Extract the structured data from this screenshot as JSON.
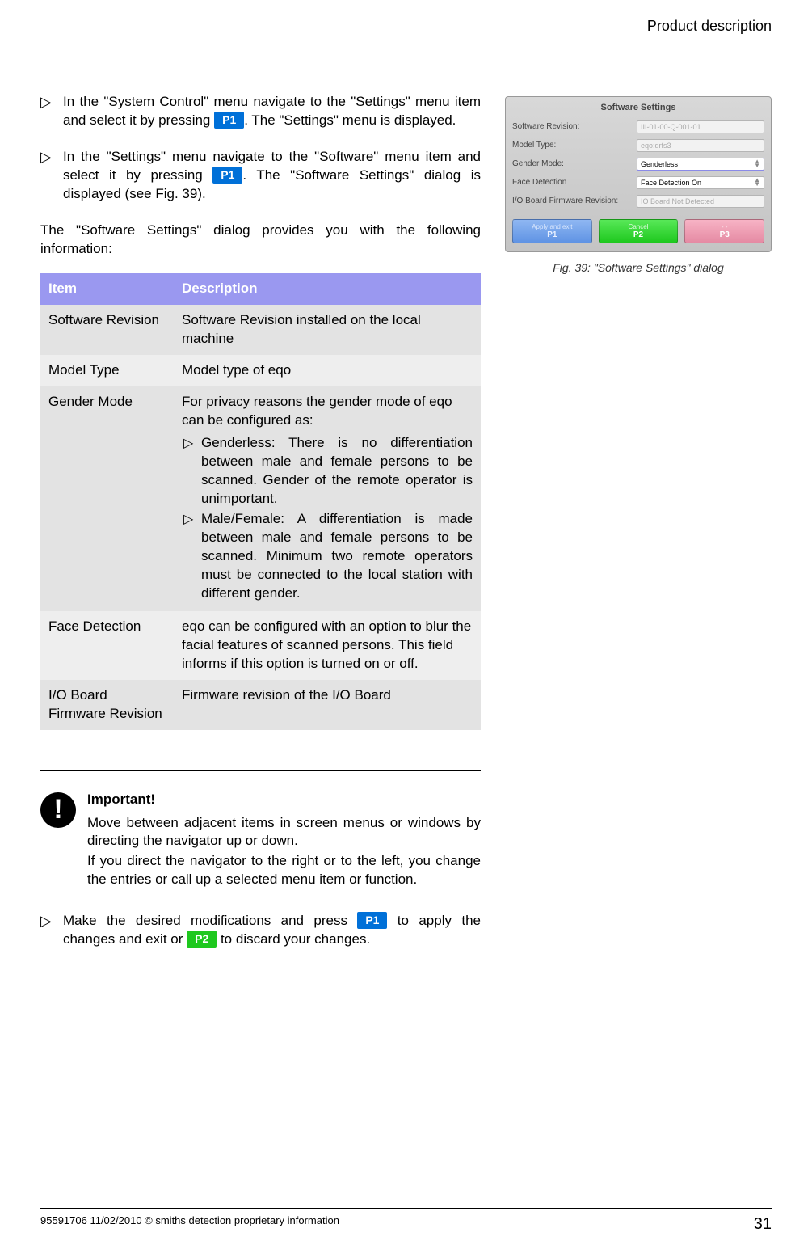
{
  "header": {
    "title": "Product description"
  },
  "steps": {
    "s1_a": "In the \"System Control\" menu navigate to the \"Settings\" menu item and select it by pressing ",
    "s1_b": ". The \"Settings\" menu is displayed.",
    "s2_a": "In the \"Settings\" menu navigate to the \"Software\" menu item and select it by pressing ",
    "s2_b": ". The \"Software Settings\" dialog is displayed (see Fig. 39).",
    "p1": "P1"
  },
  "intro": "The \"Software Settings\" dialog provides you with the following information:",
  "table": {
    "h1": "Item",
    "h2": "Description",
    "r1i": "Software Revision",
    "r1d": "Software Revision installed on the local machine",
    "r2i": "Model Type",
    "r2d": "Model type of eqo",
    "r3i": "Gender Mode",
    "r3d_intro": "For privacy reasons the gender mode of eqo can be configured as:",
    "r3d_b1": "Genderless: There is no differentiation between male and female persons to be scanned. Gender of the remote operator is unimportant.",
    "r3d_b2": "Male/Female: A differentiation is made between male and female persons to be scanned. Minimum two remote operators must be connected to the local station with different gender.",
    "r4i": "Face Detection",
    "r4d": "eqo can be configured with an option to blur the facial features of scanned persons. This field informs if this option is turned on or off.",
    "r5i": "I/O Board Firmware Revision",
    "r5d": "Firmware revision of the I/O Board"
  },
  "important": {
    "title": "Important!",
    "p1": "Move between adjacent items in screen menus or windows by directing the navigator up or down.",
    "p2": "If you direct the navigator to the right or to the left, you change the entries or call up a selected menu item or function."
  },
  "apply": {
    "a": "Make the desired modifications and press ",
    "b": " to apply the changes and exit or ",
    "c": " to discard your changes.",
    "p1": "P1",
    "p2": "P2"
  },
  "fig": {
    "title": "Software Settings",
    "l1": "Software Revision:",
    "v1": "III-01-00-Q-001-01",
    "l2": "Model Type:",
    "v2": "eqo:drfs3",
    "l3": "Gender Mode:",
    "v3": "Genderless",
    "l4": "Face Detection",
    "v4": "Face Detection On",
    "l5": "I/O Board Firmware Revision:",
    "v5": "IO Board Not Detected",
    "b1t": "Apply and exit",
    "b1p": "P1",
    "b2t": "Cancel",
    "b2p": "P2",
    "b3t": "- -",
    "b3p": "P3",
    "caption": "Fig. 39: \"Software Settings\" dialog"
  },
  "footer": {
    "left": "95591706 11/02/2010 © smiths detection proprietary information",
    "page": "31"
  },
  "marker": "▷"
}
